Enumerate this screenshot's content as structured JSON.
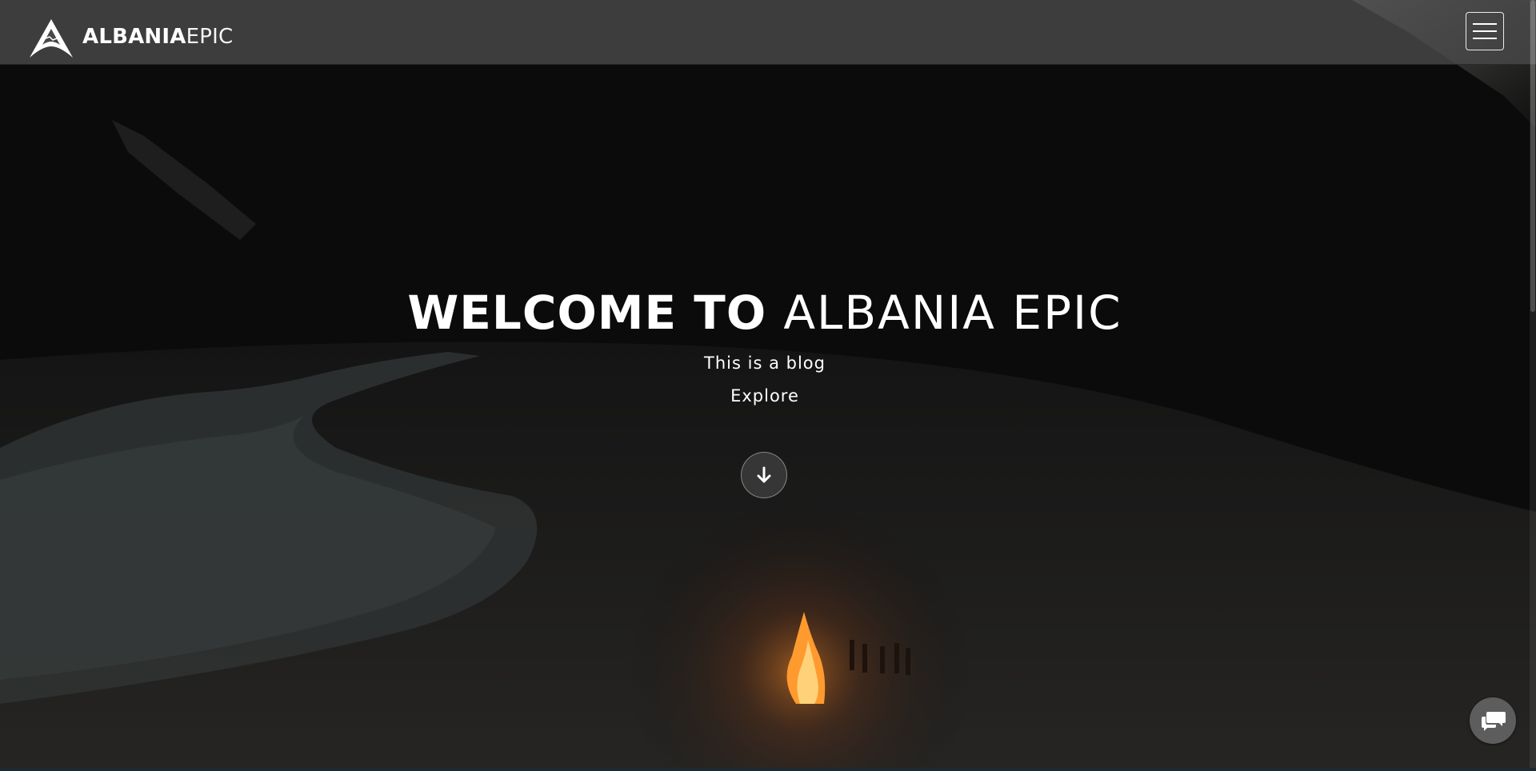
{
  "brand": {
    "name_bold": "ALBANIA",
    "name_light": "EPIC",
    "logo_icon": "mountain-logo-icon"
  },
  "header": {
    "menu_icon": "hamburger-menu-icon"
  },
  "hero": {
    "title_bold": "WELCOME TO",
    "title_light": "ALBANIA EPIC",
    "subtitle": "This is a blog",
    "explore_label": "Explore",
    "scroll_icon": "arrow-down-icon"
  },
  "chat": {
    "icon": "chat-bubbles-icon"
  },
  "colors": {
    "header_bg": "#484848",
    "text": "#ffffff",
    "hero_bg": "#0c0b0b",
    "fire": "#ff9a2e"
  }
}
